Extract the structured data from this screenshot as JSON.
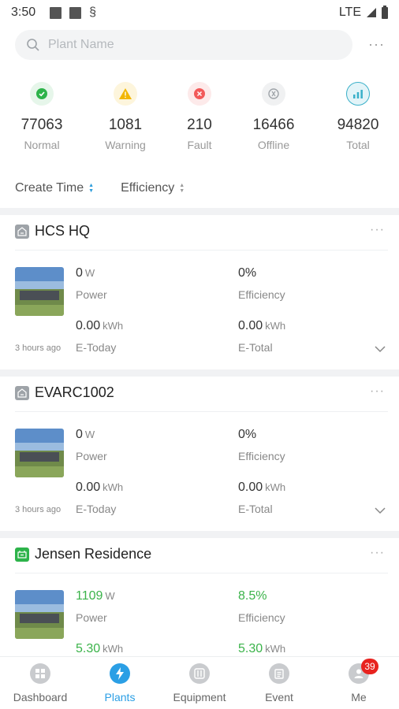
{
  "status_bar": {
    "time": "3:50",
    "network": "LTE"
  },
  "search": {
    "placeholder": "Plant Name"
  },
  "stats": [
    {
      "value": "77063",
      "label": "Normal",
      "icon": "check-icon",
      "color": "#2db34a"
    },
    {
      "value": "1081",
      "label": "Warning",
      "icon": "warning-icon",
      "color": "#f2b600"
    },
    {
      "value": "210",
      "label": "Fault",
      "icon": "fault-icon",
      "color": "#f25a5a"
    },
    {
      "value": "16466",
      "label": "Offline",
      "icon": "offline-icon",
      "color": "#b0b3b8"
    },
    {
      "value": "94820",
      "label": "Total",
      "icon": "chart-icon",
      "color": "#3ab0c9"
    }
  ],
  "sort": {
    "create_time": "Create Time",
    "efficiency": "Efficiency"
  },
  "plants": [
    {
      "name": "HCS HQ",
      "status_icon": "offline-plant-icon",
      "power": "0",
      "power_unit": "W",
      "power_label": "Power",
      "efficiency": "0%",
      "efficiency_label": "Efficiency",
      "e_today": "0.00",
      "e_today_unit": "kWh",
      "e_today_label": "E-Today",
      "e_total": "0.00",
      "e_total_unit": "kWh",
      "e_total_label": "E-Total",
      "updated": "3 hours ago"
    },
    {
      "name": "EVARC1002",
      "status_icon": "offline-plant-icon",
      "power": "0",
      "power_unit": "W",
      "power_label": "Power",
      "efficiency": "0%",
      "efficiency_label": "Efficiency",
      "e_today": "0.00",
      "e_today_unit": "kWh",
      "e_today_label": "E-Today",
      "e_total": "0.00",
      "e_total_unit": "kWh",
      "e_total_label": "E-Total",
      "updated": "3 hours ago"
    },
    {
      "name": "Jensen Residence",
      "status_icon": "online-plant-icon",
      "power": "1109",
      "power_unit": "W",
      "power_label": "Power",
      "efficiency": "8.5%",
      "efficiency_label": "Efficiency",
      "e_today": "5.30",
      "e_today_unit": "kWh",
      "e_total": "5.30",
      "e_total_unit": "kWh"
    }
  ],
  "nav": [
    {
      "label": "Dashboard",
      "icon": "dashboard-icon"
    },
    {
      "label": "Plants",
      "icon": "plants-icon",
      "active": true
    },
    {
      "label": "Equipment",
      "icon": "equipment-icon"
    },
    {
      "label": "Event",
      "icon": "event-icon"
    },
    {
      "label": "Me",
      "icon": "me-icon",
      "badge": "39"
    }
  ],
  "colors": {
    "accent": "#2b9fe5",
    "green": "#3bb34a",
    "badge": "#e8231f"
  }
}
